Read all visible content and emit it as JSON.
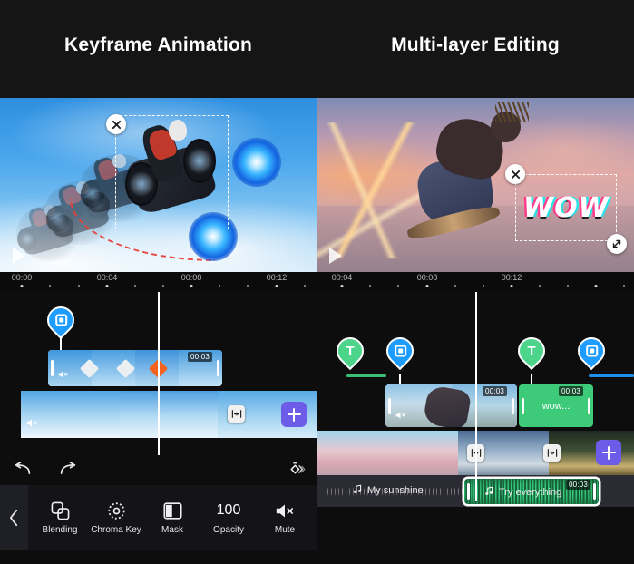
{
  "header": {
    "left_title": "Keyframe Animation",
    "right_title": "Multi-layer Editing"
  },
  "colors": {
    "clip_blue": "#1f9cff",
    "clip_green": "#3dcb7a",
    "marker_green": "#4bd48a",
    "marker_blue": "#1f9cff",
    "plus_purple": "#6c5ce7",
    "keyframe_active": "#f4631e",
    "keyframe_idle": "#e8e8e8",
    "audio_green": "#35c97a",
    "trajectory_red": "#e8413a"
  },
  "left_panel": {
    "preview": {
      "overlay_text": "",
      "close_label": "✕",
      "resize_label": "⤡",
      "play_label": "▶"
    },
    "ruler": {
      "labels": [
        "00:00",
        "00:04",
        "00:08",
        "00:12"
      ]
    },
    "marker": {
      "type": "keyframe-marker",
      "icon": "keyframe-square-icon"
    },
    "video_clip": {
      "duration_badge": "00:03",
      "keyframes": [
        "idle",
        "idle",
        "active",
        "idle"
      ],
      "muted": true
    },
    "background_clip": {
      "muted": true,
      "split_button": "split-icon",
      "add_button": "+"
    },
    "undo_bar": {
      "undo": "undo-icon",
      "redo": "redo-icon",
      "keyframe": "keyframe-motion-icon"
    },
    "toolbar": {
      "back": "‹",
      "items": [
        {
          "label": "Blending",
          "icon": "blending-icon",
          "value": ""
        },
        {
          "label": "Chroma Key",
          "icon": "chroma-key-icon",
          "value": ""
        },
        {
          "label": "Mask",
          "icon": "mask-icon",
          "value": ""
        },
        {
          "label": "Opacity",
          "icon": "opacity-value",
          "value": "100"
        },
        {
          "label": "Mute",
          "icon": "mute-icon",
          "value": ""
        }
      ]
    }
  },
  "right_panel": {
    "preview": {
      "overlay_text": "WOW",
      "close_label": "✕",
      "resize_label": "⤡",
      "play_label": "▶"
    },
    "ruler": {
      "labels": [
        "00:04",
        "00:08",
        "00:12"
      ]
    },
    "markers": [
      {
        "type": "text-marker",
        "glyph": "T",
        "color": "#4bd48a"
      },
      {
        "type": "keyframe-marker",
        "glyph": "",
        "color": "#1f9cff"
      },
      {
        "type": "text-marker",
        "glyph": "T",
        "color": "#4bd48a"
      },
      {
        "type": "keyframe-marker",
        "glyph": "",
        "color": "#1f9cff"
      }
    ],
    "video_clip": {
      "duration_badge": "00:03",
      "muted": true
    },
    "text_clip": {
      "label": "wow...",
      "duration_badge": "00:03"
    },
    "background_clips": {
      "split_buttons": 2,
      "add_button": "+"
    },
    "audio_track": {
      "track_label": "My sunshine",
      "clip_label": "Try everything",
      "clip_badge": "00:03"
    }
  }
}
